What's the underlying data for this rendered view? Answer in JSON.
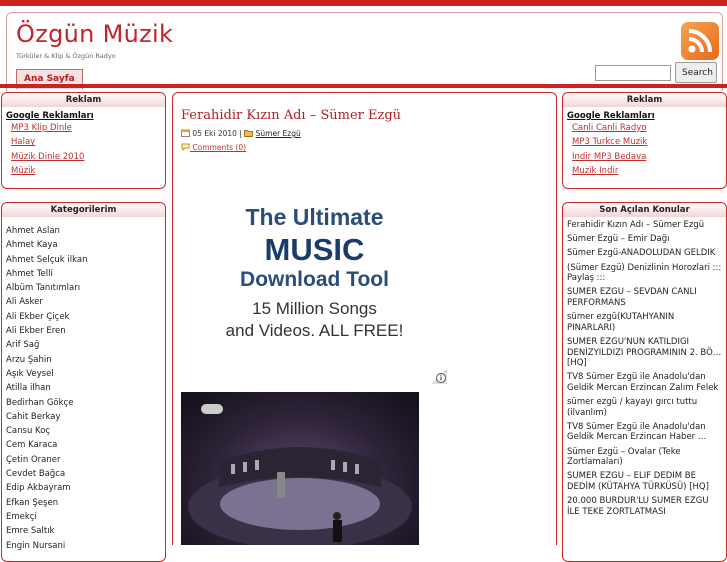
{
  "site": {
    "title": "Özgün Müzik",
    "subtitle": "Türküler & Klip & Özgün Radyo",
    "nav": [
      "Ana Sayfa"
    ],
    "search_label": "Search",
    "search_value": ""
  },
  "left_ads": {
    "title": "Reklam",
    "label": "Google Reklamları",
    "items": [
      "MP3 Klip Dinle",
      "Halay",
      "Müzik Dinle 2010",
      "Müzik"
    ]
  },
  "categories": {
    "title": "Kategorilerim",
    "items": [
      "Ahmet Aslan",
      "Ahmet Kaya",
      "Ahmet Selçuk ilkan",
      "Ahmet Telli",
      "Albüm Tanıtımları",
      "Ali Asker",
      "Ali Ekber Çiçek",
      "Ali Ekber Eren",
      "Arif Sağ",
      "Arzu Şahin",
      "Aşık Veysel",
      "Atilla ilhan",
      "Bedirhan Gökçe",
      "Cahit Berkay",
      "Cansu Koç",
      "Cem Karaca",
      "Çetin Oraner",
      "Cevdet Bağca",
      "Edip Akbayram",
      "Efkan Şeşen",
      "Emekçi",
      "Emre Saltık",
      "Engin Nursani"
    ]
  },
  "right_ads": {
    "title": "Reklam",
    "label": "Google Reklamları",
    "items": [
      "Canli Canli Radyo",
      "MP3 Turkce Muzik",
      "Indir MP3 Bedava",
      "Muzik Indir"
    ]
  },
  "recent": {
    "title": "Son Açılan Konular",
    "items": [
      "Ferahidir Kızın Adı – Sümer Ezgü",
      "Sümer Ezgü – Emir Dağı",
      "Sümer Ezgü-ANADOLUDAN GELDİK",
      "(Sümer Ezgü) Denizlinin Horozlari ::: Paylaş :::",
      "SÜMER EZGÜ – SEVDAN CANLI PERFORMANS",
      "sümer ezgü(KÜTAHYANIN PINARLARI)",
      "SÜMER EZGÜ'NÜN KATILDIĞI DENİZYILDIZI PROGRAMININ 2. BÖ… [HQ]",
      "TV8 Sümer Ezgü ile Anadolu'dan Geldik Mercan Erzincan Zalım Felek",
      "sümer ezgü / kayayı gırcı tuttu (ilvanlım)",
      "TV8 Sümer Ezgü ile Anadolu'dan Geldik Mercan Erzincan Haber …",
      "Sümer Ezgü – Ovalar (Teke Zortlamaları)",
      "SÜMER EZGÜ – ELİF DEDİM BE DEDİM (KÜTAHYA TÜRKÜSÜ) [HQ]",
      "20.000 BURDUR'LU SÜMER EZGÜ İLE TEKE ZORTLATMASI"
    ]
  },
  "post": {
    "title": "Ferahidir Kızın Adı – Sümer Ezgü",
    "date": "05 Eki 2010",
    "category": "Sümer Ezgü",
    "comments": "Comments (0)"
  },
  "ad_banner": {
    "line1": "The Ultimate",
    "line2": "MUSIC",
    "line3": "Download Tool",
    "line4": "15 Million Songs",
    "line5": "and Videos. ALL FREE!"
  },
  "colors": {
    "accent": "#cc2222",
    "link": "#c03030",
    "ad_blue": "#1a3c6b"
  }
}
